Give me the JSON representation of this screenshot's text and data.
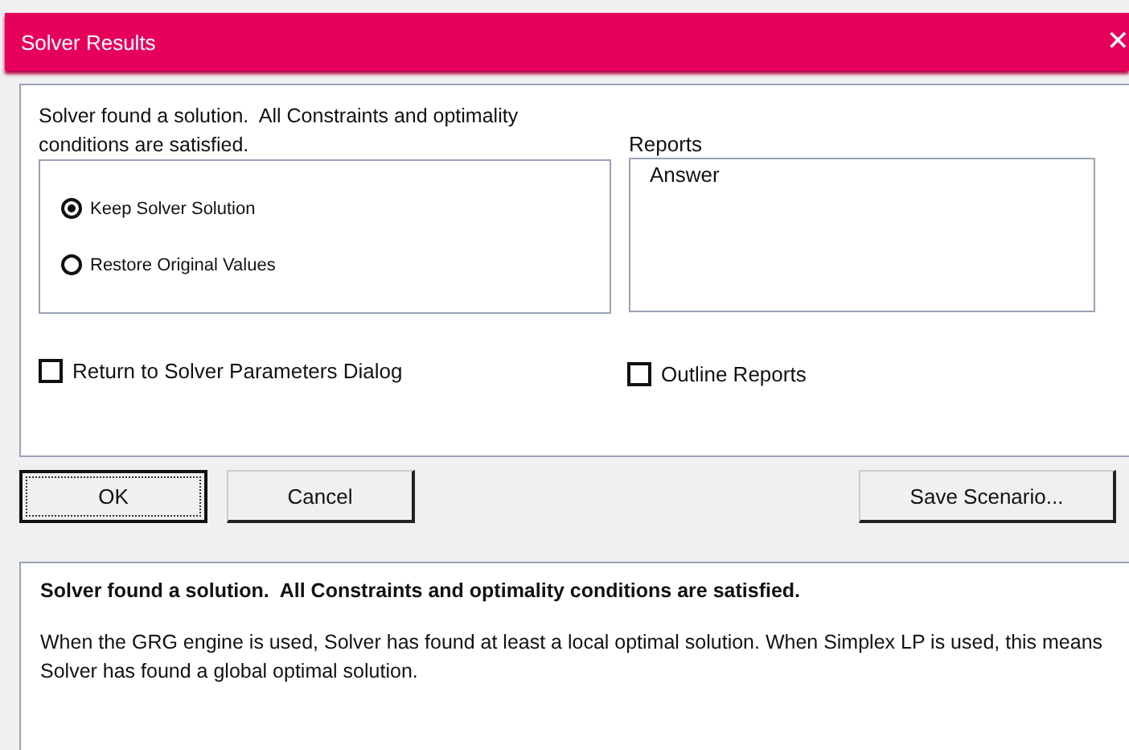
{
  "window": {
    "title": "Solver Results",
    "close": "✕"
  },
  "message": "Solver found a solution.  All Constraints and optimality conditions are satisfied.",
  "options": [
    {
      "label": "Keep Solver Solution",
      "selected": true
    },
    {
      "label": "Restore Original Values",
      "selected": false
    }
  ],
  "reports": {
    "label": "Reports",
    "items": [
      {
        "label": "Answer",
        "selected": false
      }
    ]
  },
  "checkboxes": [
    {
      "label": "Return to Solver Parameters Dialog",
      "checked": false
    },
    {
      "label": "Outline Reports",
      "checked": false
    }
  ],
  "buttons": [
    {
      "label": "OK",
      "default": true
    },
    {
      "label": "Cancel",
      "default": false
    }
  ],
  "save_button": "Save Scenario...",
  "details": {
    "heading": "Solver found a solution.  All Constraints and optimality conditions are satisfied.",
    "body": "When the GRG engine is used, Solver has found at least a local optimal solution. When Simplex LP is used, this means Solver has found a global optimal solution."
  }
}
